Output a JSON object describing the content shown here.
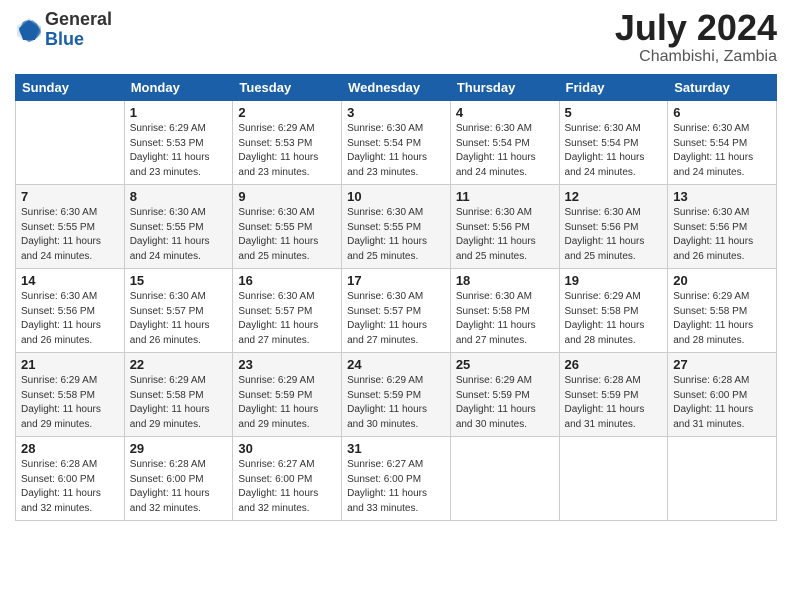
{
  "logo": {
    "general": "General",
    "blue": "Blue"
  },
  "title": {
    "month_year": "July 2024",
    "location": "Chambishi, Zambia"
  },
  "weekdays": [
    "Sunday",
    "Monday",
    "Tuesday",
    "Wednesday",
    "Thursday",
    "Friday",
    "Saturday"
  ],
  "weeks": [
    [
      {
        "day": "",
        "info": ""
      },
      {
        "day": "1",
        "info": "Sunrise: 6:29 AM\nSunset: 5:53 PM\nDaylight: 11 hours\nand 23 minutes."
      },
      {
        "day": "2",
        "info": "Sunrise: 6:29 AM\nSunset: 5:53 PM\nDaylight: 11 hours\nand 23 minutes."
      },
      {
        "day": "3",
        "info": "Sunrise: 6:30 AM\nSunset: 5:54 PM\nDaylight: 11 hours\nand 23 minutes."
      },
      {
        "day": "4",
        "info": "Sunrise: 6:30 AM\nSunset: 5:54 PM\nDaylight: 11 hours\nand 24 minutes."
      },
      {
        "day": "5",
        "info": "Sunrise: 6:30 AM\nSunset: 5:54 PM\nDaylight: 11 hours\nand 24 minutes."
      },
      {
        "day": "6",
        "info": "Sunrise: 6:30 AM\nSunset: 5:54 PM\nDaylight: 11 hours\nand 24 minutes."
      }
    ],
    [
      {
        "day": "7",
        "info": "Sunrise: 6:30 AM\nSunset: 5:55 PM\nDaylight: 11 hours\nand 24 minutes."
      },
      {
        "day": "8",
        "info": "Sunrise: 6:30 AM\nSunset: 5:55 PM\nDaylight: 11 hours\nand 24 minutes."
      },
      {
        "day": "9",
        "info": "Sunrise: 6:30 AM\nSunset: 5:55 PM\nDaylight: 11 hours\nand 25 minutes."
      },
      {
        "day": "10",
        "info": "Sunrise: 6:30 AM\nSunset: 5:55 PM\nDaylight: 11 hours\nand 25 minutes."
      },
      {
        "day": "11",
        "info": "Sunrise: 6:30 AM\nSunset: 5:56 PM\nDaylight: 11 hours\nand 25 minutes."
      },
      {
        "day": "12",
        "info": "Sunrise: 6:30 AM\nSunset: 5:56 PM\nDaylight: 11 hours\nand 25 minutes."
      },
      {
        "day": "13",
        "info": "Sunrise: 6:30 AM\nSunset: 5:56 PM\nDaylight: 11 hours\nand 26 minutes."
      }
    ],
    [
      {
        "day": "14",
        "info": "Sunrise: 6:30 AM\nSunset: 5:56 PM\nDaylight: 11 hours\nand 26 minutes."
      },
      {
        "day": "15",
        "info": "Sunrise: 6:30 AM\nSunset: 5:57 PM\nDaylight: 11 hours\nand 26 minutes."
      },
      {
        "day": "16",
        "info": "Sunrise: 6:30 AM\nSunset: 5:57 PM\nDaylight: 11 hours\nand 27 minutes."
      },
      {
        "day": "17",
        "info": "Sunrise: 6:30 AM\nSunset: 5:57 PM\nDaylight: 11 hours\nand 27 minutes."
      },
      {
        "day": "18",
        "info": "Sunrise: 6:30 AM\nSunset: 5:58 PM\nDaylight: 11 hours\nand 27 minutes."
      },
      {
        "day": "19",
        "info": "Sunrise: 6:29 AM\nSunset: 5:58 PM\nDaylight: 11 hours\nand 28 minutes."
      },
      {
        "day": "20",
        "info": "Sunrise: 6:29 AM\nSunset: 5:58 PM\nDaylight: 11 hours\nand 28 minutes."
      }
    ],
    [
      {
        "day": "21",
        "info": "Sunrise: 6:29 AM\nSunset: 5:58 PM\nDaylight: 11 hours\nand 29 minutes."
      },
      {
        "day": "22",
        "info": "Sunrise: 6:29 AM\nSunset: 5:58 PM\nDaylight: 11 hours\nand 29 minutes."
      },
      {
        "day": "23",
        "info": "Sunrise: 6:29 AM\nSunset: 5:59 PM\nDaylight: 11 hours\nand 29 minutes."
      },
      {
        "day": "24",
        "info": "Sunrise: 6:29 AM\nSunset: 5:59 PM\nDaylight: 11 hours\nand 30 minutes."
      },
      {
        "day": "25",
        "info": "Sunrise: 6:29 AM\nSunset: 5:59 PM\nDaylight: 11 hours\nand 30 minutes."
      },
      {
        "day": "26",
        "info": "Sunrise: 6:28 AM\nSunset: 5:59 PM\nDaylight: 11 hours\nand 31 minutes."
      },
      {
        "day": "27",
        "info": "Sunrise: 6:28 AM\nSunset: 6:00 PM\nDaylight: 11 hours\nand 31 minutes."
      }
    ],
    [
      {
        "day": "28",
        "info": "Sunrise: 6:28 AM\nSunset: 6:00 PM\nDaylight: 11 hours\nand 32 minutes."
      },
      {
        "day": "29",
        "info": "Sunrise: 6:28 AM\nSunset: 6:00 PM\nDaylight: 11 hours\nand 32 minutes."
      },
      {
        "day": "30",
        "info": "Sunrise: 6:27 AM\nSunset: 6:00 PM\nDaylight: 11 hours\nand 32 minutes."
      },
      {
        "day": "31",
        "info": "Sunrise: 6:27 AM\nSunset: 6:00 PM\nDaylight: 11 hours\nand 33 minutes."
      },
      {
        "day": "",
        "info": ""
      },
      {
        "day": "",
        "info": ""
      },
      {
        "day": "",
        "info": ""
      }
    ]
  ]
}
